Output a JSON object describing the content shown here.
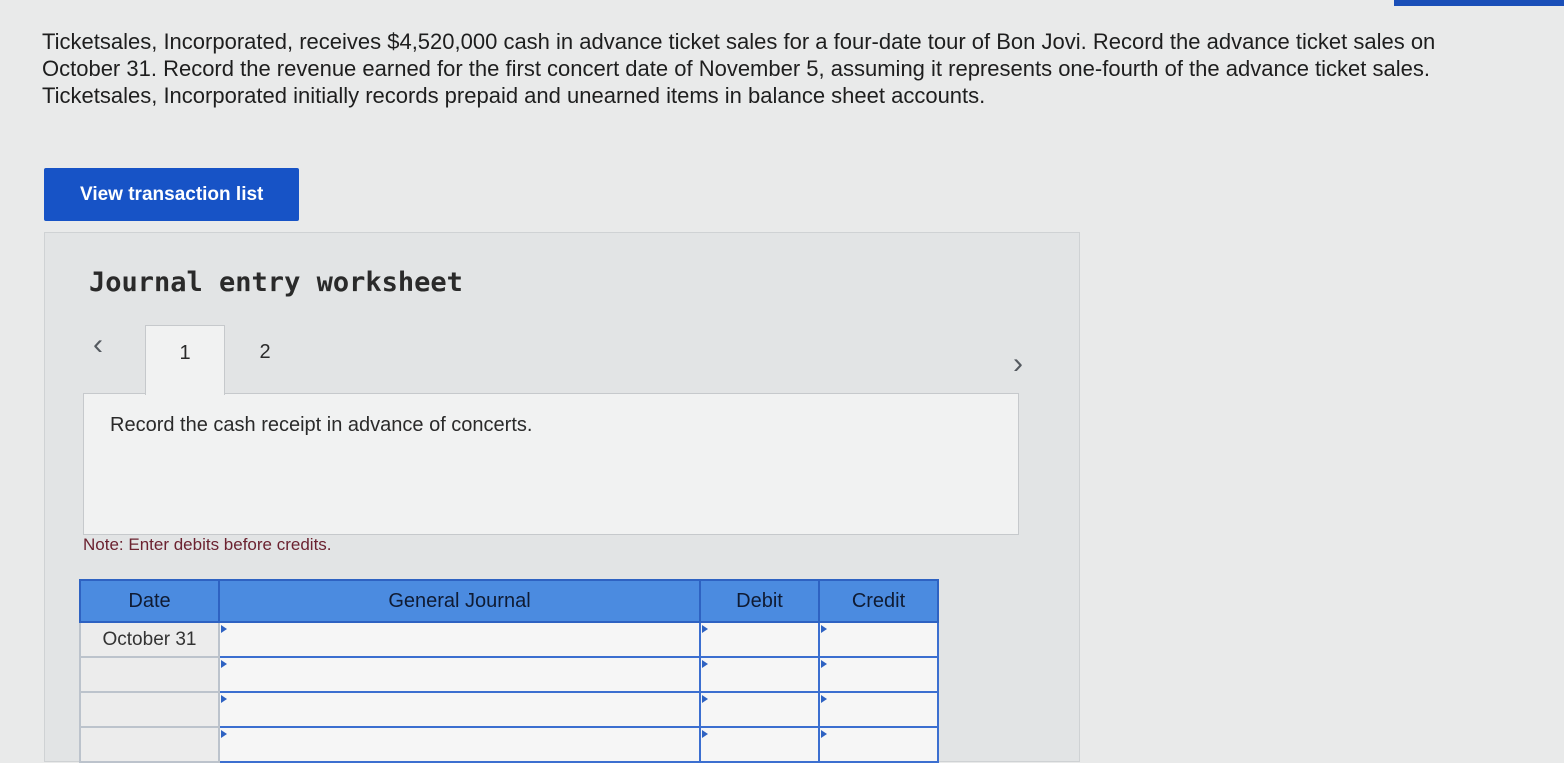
{
  "question": {
    "text": "Ticketsales, Incorporated, receives $4,520,000 cash in advance ticket sales for a four-date tour of Bon Jovi. Record the advance ticket sales on October 31. Record the revenue earned for the first concert date of November 5, assuming it represents one-fourth of the advance ticket sales. Ticketsales, Incorporated initially records prepaid and unearned items in balance sheet accounts."
  },
  "view_button": {
    "label": "View transaction list"
  },
  "worksheet": {
    "title": "Journal entry worksheet",
    "prev_icon": "chevron-left-icon",
    "next_icon": "chevron-right-icon",
    "tabs": [
      {
        "label": "1",
        "active": true
      },
      {
        "label": "2",
        "active": false
      }
    ],
    "instruction": "Record the cash receipt in advance of concerts.",
    "note": "Note: Enter debits before credits.",
    "table": {
      "headers": [
        "Date",
        "General Journal",
        "Debit",
        "Credit"
      ],
      "rows": [
        {
          "date": "October 31",
          "general_journal": "",
          "debit": "",
          "credit": ""
        },
        {
          "date": "",
          "general_journal": "",
          "debit": "",
          "credit": ""
        },
        {
          "date": "",
          "general_journal": "",
          "debit": "",
          "credit": ""
        },
        {
          "date": "",
          "general_journal": "",
          "debit": "",
          "credit": ""
        }
      ]
    }
  },
  "colors": {
    "button_blue": "#1753c6",
    "header_blue": "#4b8be0",
    "border_blue": "#2e62c2",
    "note_text": "#6b2230"
  }
}
